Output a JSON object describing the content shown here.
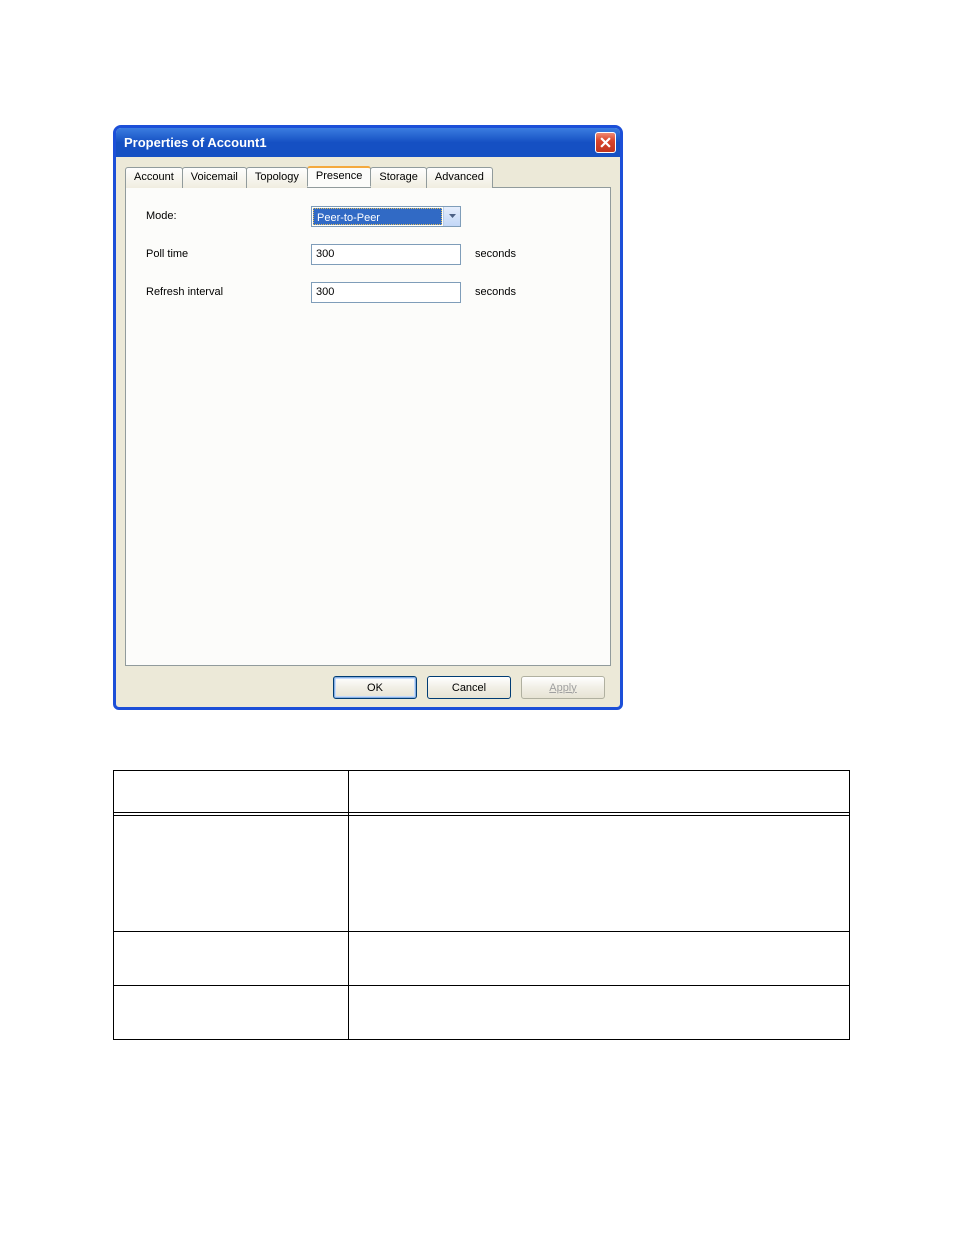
{
  "dialog": {
    "title": "Properties of Account1",
    "tabs": {
      "t0": "Account",
      "t1": "Voicemail",
      "t2": "Topology",
      "t3": "Presence",
      "t4": "Storage",
      "t5": "Advanced"
    },
    "form": {
      "mode_label": "Mode:",
      "mode_value": "Peer-to-Peer",
      "poll_label": "Poll time",
      "poll_value": "300",
      "poll_unit": "seconds",
      "refresh_label": "Refresh interval",
      "refresh_value": "300",
      "refresh_unit": "seconds"
    },
    "buttons": {
      "ok": "OK",
      "cancel": "Cancel",
      "apply": "Apply"
    }
  }
}
